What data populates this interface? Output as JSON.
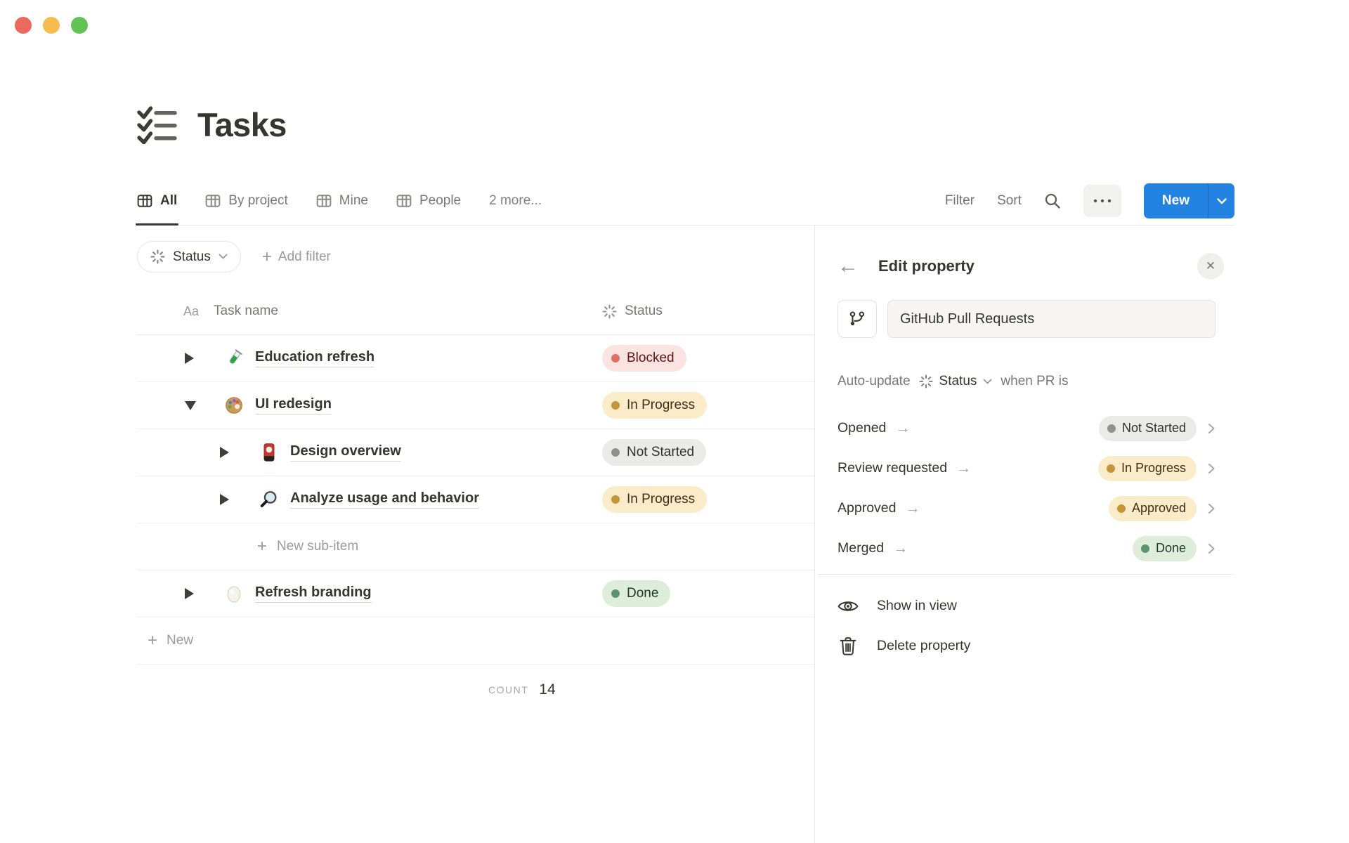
{
  "window": {
    "controls": [
      "close",
      "minimize",
      "zoom"
    ]
  },
  "header": {
    "title": "Tasks",
    "title_icon": "checklist-icon"
  },
  "tabs": {
    "items": [
      {
        "label": "All",
        "active": true
      },
      {
        "label": "By project",
        "active": false
      },
      {
        "label": "Mine",
        "active": false
      },
      {
        "label": "People",
        "active": false
      }
    ],
    "more_label": "2 more..."
  },
  "toolbar": {
    "filter": "Filter",
    "sort": "Sort",
    "search_icon": "search-icon",
    "more_icon": "ellipsis-icon",
    "new": "New"
  },
  "filter_bar": {
    "status_filter": "Status",
    "status_icon": "status-spinner-icon",
    "add_filter": "Add filter"
  },
  "table": {
    "header": {
      "name_col_icon": "Aa",
      "name_col": "Task name",
      "status_col": "Status"
    },
    "rows": [
      {
        "name": "Education refresh",
        "icon": "test-tube-emoji",
        "level": 0,
        "toggle": "collapsed",
        "status": "Blocked",
        "status_color": "red"
      },
      {
        "name": "UI redesign",
        "icon": "palette-emoji",
        "level": 0,
        "toggle": "expanded",
        "status": "In Progress",
        "status_color": "yellow"
      },
      {
        "name": "Design overview",
        "icon": "flower-card-emoji",
        "level": 1,
        "toggle": "collapsed",
        "status": "Not Started",
        "status_color": "gray"
      },
      {
        "name": "Analyze usage and behavior",
        "icon": "magnifier-emoji",
        "level": 1,
        "toggle": "collapsed",
        "status": "In Progress",
        "status_color": "yellow"
      },
      {
        "name": "Refresh branding",
        "icon": "egg-emoji",
        "level": 0,
        "toggle": "collapsed",
        "status": "Done",
        "status_color": "green"
      }
    ],
    "new_sub_item": "New sub-item",
    "new_row": "New",
    "count_label": "COUNT",
    "count_value": "14"
  },
  "panel": {
    "title": "Edit property",
    "property_icon": "pull-request-icon",
    "property_name": "GitHub Pull Requests",
    "auto_update_prefix": "Auto-update",
    "auto_update_property": "Status",
    "auto_update_suffix": "when PR is",
    "mappings": [
      {
        "event": "Opened",
        "status": "Not Started",
        "status_color": "gray"
      },
      {
        "event": "Review requested",
        "status": "In Progress",
        "status_color": "yellow"
      },
      {
        "event": "Approved",
        "status": "Approved",
        "status_color": "yellow"
      },
      {
        "event": "Merged",
        "status": "Done",
        "status_color": "green"
      }
    ],
    "menu": [
      {
        "icon": "eye-icon",
        "label": "Show in view"
      },
      {
        "icon": "trash-icon",
        "label": "Delete property"
      }
    ]
  },
  "colors": {
    "accent_blue": "#2383E2",
    "text_primary": "#37352F",
    "text_secondary": "#787774",
    "divider": "#E9E9E7",
    "status_red_bg": "#FAE4E2",
    "status_red_dot": "#E16F64",
    "status_red_text": "#5D1715",
    "status_yellow_bg": "#FBECC9",
    "status_yellow_dot": "#C5943B",
    "status_yellow_text": "#402C1B",
    "status_gray_bg": "#EAEAE8",
    "status_gray_dot": "#90908C",
    "status_gray_text": "#32302C",
    "status_green_bg": "#DEEDDA",
    "status_green_dot": "#5C9470",
    "status_green_text": "#1C3829"
  }
}
